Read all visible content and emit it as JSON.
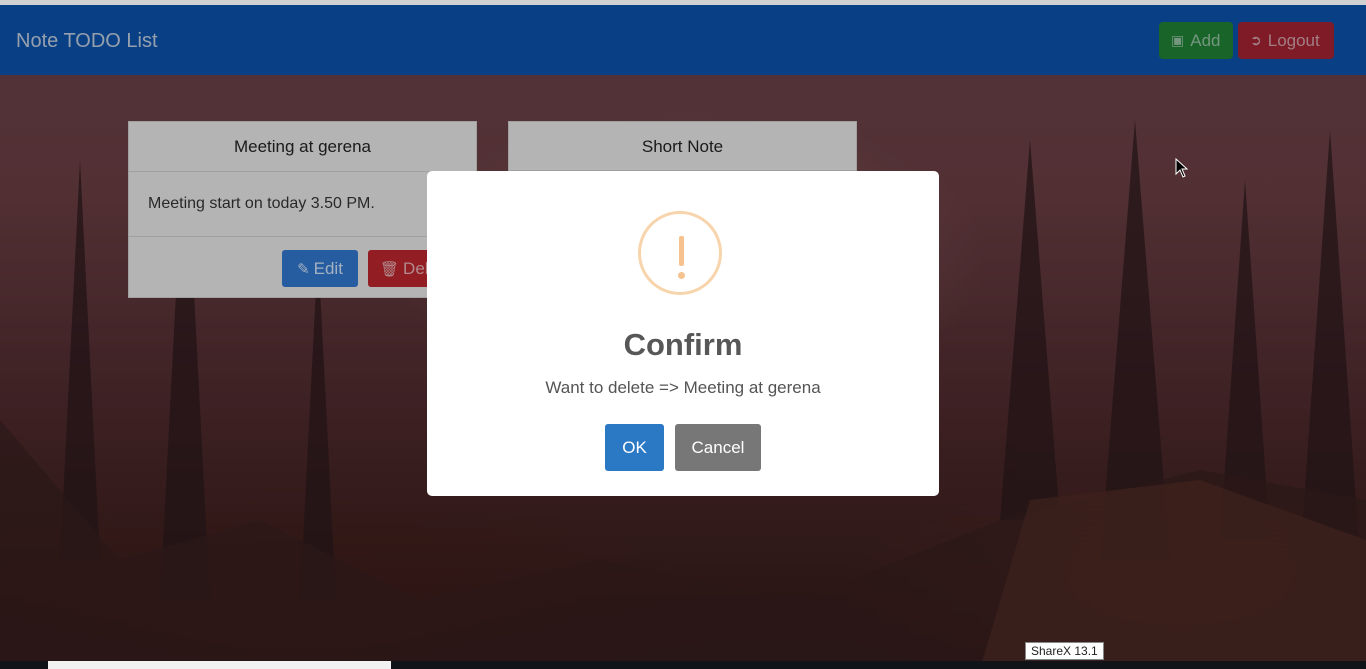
{
  "app": {
    "brand": "Note TODO List"
  },
  "navbar": {
    "add_label": "Add",
    "logout_label": "Logout",
    "add_icon": "plus-square-icon",
    "logout_icon": "sign-out-icon"
  },
  "cards": [
    {
      "title": "Meeting at gerena",
      "body": "Meeting start on today 3.50 PM.",
      "edit_label": "Edit",
      "delete_label": "Delete"
    },
    {
      "title": "Short Note"
    }
  ],
  "modal": {
    "title": "Confirm",
    "text": "Want to delete => Meeting at gerena",
    "ok_label": "OK",
    "cancel_label": "Cancel",
    "icon": "warning-icon"
  },
  "system": {
    "tooltip": "ShareX 13.1"
  },
  "colors": {
    "navbar": "#0b4fa3",
    "add_button": "#1f7a33",
    "logout_button": "#9b2230",
    "edit_button": "#2f72c4",
    "delete_button": "#b3242b",
    "ok_button": "#2b78c5",
    "cancel_button": "#777777",
    "warning": "#f8d4ac"
  }
}
